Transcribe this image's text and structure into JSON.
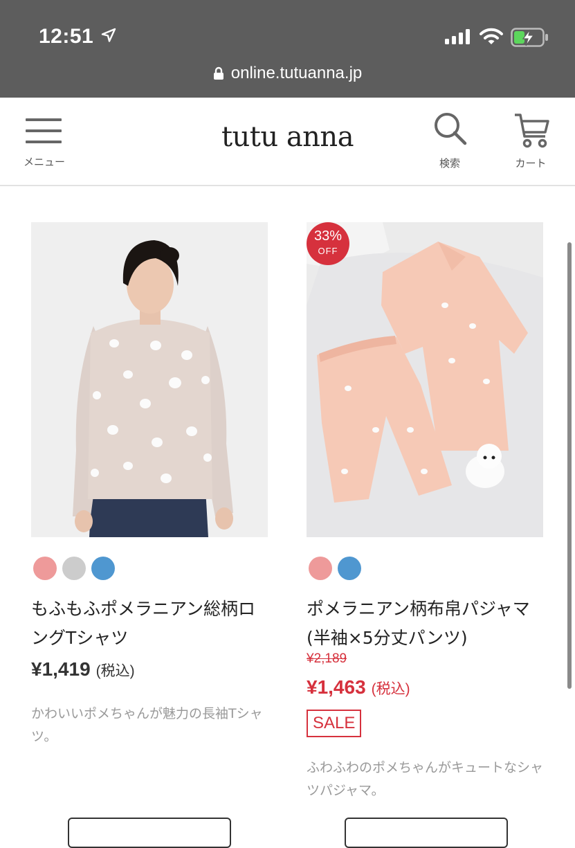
{
  "status_bar": {
    "time": "12:51"
  },
  "browser": {
    "url": "online.tutuanna.jp"
  },
  "header": {
    "menu_label": "メニュー",
    "logo": "tutu anna",
    "search_label": "検索",
    "cart_label": "カート"
  },
  "products": [
    {
      "name": "もふもふポメラニアン総柄ロングTシャツ",
      "price": "¥1,419",
      "tax_label": "(税込)",
      "description": "かわいいポメちゃんが魅力の長袖Tシャツ。",
      "swatches": [
        "#ee9a9a",
        "#cccccc",
        "#4f97d0"
      ]
    },
    {
      "discount_percent": "33%",
      "discount_off": "OFF",
      "name": "ポメラニアン柄布帛パジャマ(半袖×5分丈パンツ)",
      "original_price": "¥2,189",
      "price": "¥1,463",
      "tax_label": "(税込)",
      "sale_label": "SALE",
      "description": "ふわふわのポメちゃんがキュートなシャツパジャマ。",
      "swatches": [
        "#ee9a9a",
        "#4f97d0"
      ]
    }
  ],
  "colors": {
    "sale_red": "#d6313d",
    "topbar": "#5d5d5d"
  }
}
